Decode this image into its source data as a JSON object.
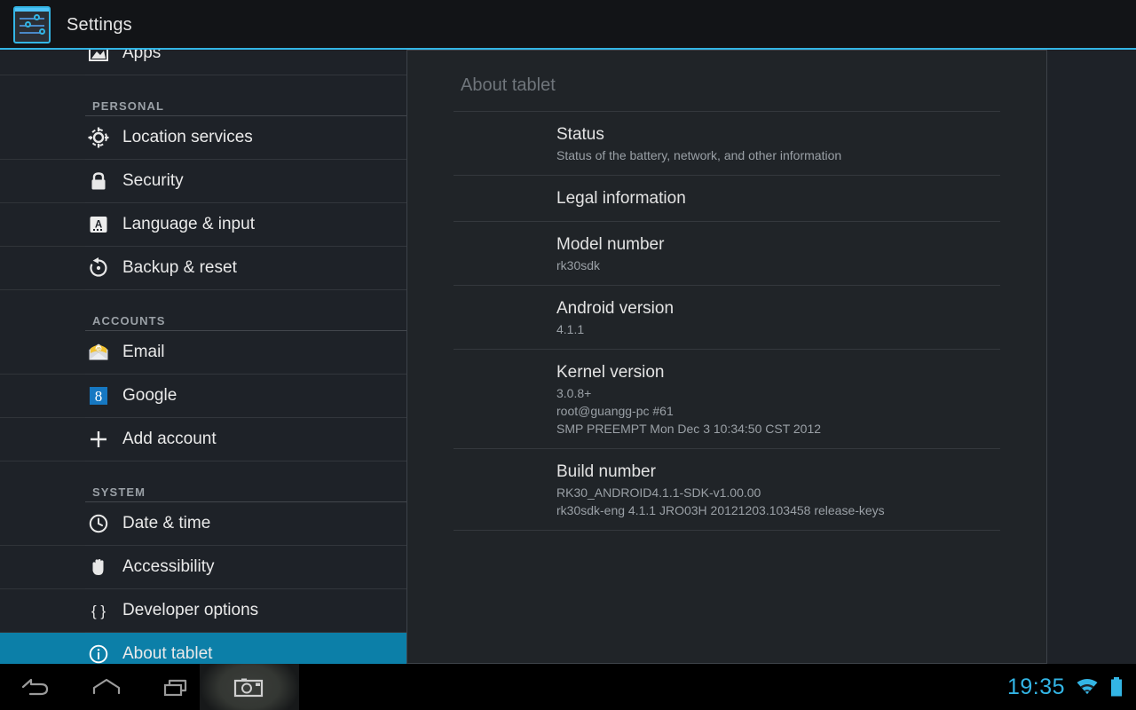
{
  "header": {
    "app_title": "Settings",
    "app_icon": "settings-sliders-icon"
  },
  "sidebar": {
    "items": [
      {
        "type": "row",
        "label": "Apps",
        "icon": "apps-image-icon",
        "selected": false,
        "clipped": true
      },
      {
        "type": "header",
        "label": "PERSONAL"
      },
      {
        "type": "row",
        "label": "Location services",
        "icon": "location-crosshair-icon",
        "selected": false
      },
      {
        "type": "row",
        "label": "Security",
        "icon": "lock-icon",
        "selected": false
      },
      {
        "type": "row",
        "label": "Language & input",
        "icon": "keyboard-a-icon",
        "selected": false
      },
      {
        "type": "row",
        "label": "Backup & reset",
        "icon": "restore-arrow-icon",
        "selected": false
      },
      {
        "type": "header",
        "label": "ACCOUNTS"
      },
      {
        "type": "row",
        "label": "Email",
        "icon": "envelope-at-icon",
        "selected": false
      },
      {
        "type": "row",
        "label": "Google",
        "icon": "google-g-icon",
        "selected": false
      },
      {
        "type": "row",
        "label": "Add account",
        "icon": "plus-icon",
        "selected": false
      },
      {
        "type": "header",
        "label": "SYSTEM"
      },
      {
        "type": "row",
        "label": "Date & time",
        "icon": "clock-icon",
        "selected": false
      },
      {
        "type": "row",
        "label": "Accessibility",
        "icon": "hand-icon",
        "selected": false
      },
      {
        "type": "row",
        "label": "Developer options",
        "icon": "braces-icon",
        "selected": false
      },
      {
        "type": "row",
        "label": "About tablet",
        "icon": "info-circle-icon",
        "selected": true
      }
    ],
    "selected_color": "#0c7fa8"
  },
  "panel": {
    "title": "About tablet",
    "items": [
      {
        "title": "Status",
        "lines": [
          "Status of the battery, network, and other information"
        ]
      },
      {
        "title": "Legal information",
        "lines": []
      },
      {
        "title": "Model number",
        "lines": [
          "rk30sdk"
        ]
      },
      {
        "title": "Android version",
        "lines": [
          "4.1.1"
        ]
      },
      {
        "title": "Kernel version",
        "lines": [
          "3.0.8+",
          "root@guangg-pc #61",
          "SMP PREEMPT Mon Dec 3 10:34:50 CST 2012"
        ]
      },
      {
        "title": "Build number",
        "lines": [
          "RK30_ANDROID4.1.1-SDK-v1.00.00",
          "rk30sdk-eng 4.1.1 JRO03H 20121203.103458 release-keys"
        ]
      }
    ]
  },
  "navbar": {
    "back": "back-icon",
    "home": "home-icon",
    "recent": "recent-apps-icon",
    "camera": "screenshot-camera-icon",
    "clock": "19:35",
    "wifi": "wifi-icon",
    "battery": "battery-icon",
    "accent_color": "#33b5e5"
  }
}
